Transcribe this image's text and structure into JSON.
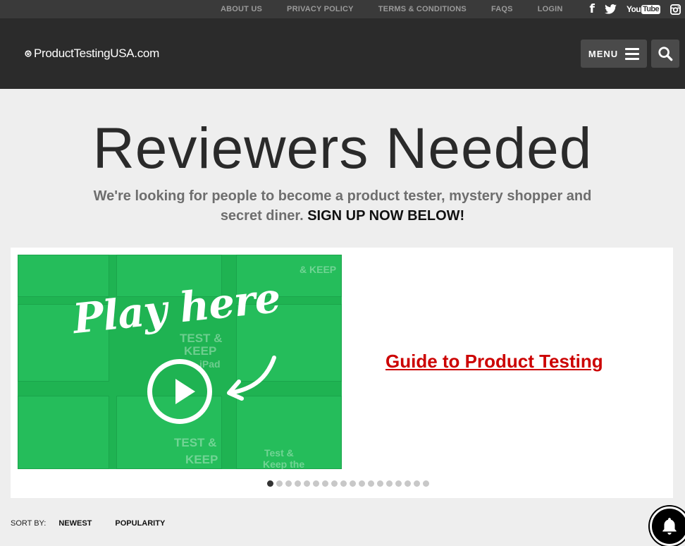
{
  "topbar": {
    "links": [
      "ABOUT US",
      "PRIVACY POLICY",
      "TERMS & CONDITIONS",
      "FAQS",
      "LOGIN"
    ],
    "social": {
      "facebook": "f",
      "youtube_you": "You",
      "youtube_tube": "Tube"
    }
  },
  "header": {
    "logo_text": "ProductTestingUSA.com",
    "menu_label": "MENU"
  },
  "hero": {
    "title": "Reviewers Needed",
    "subtitle": "We're looking for people to become a product tester, mystery shopper and secret diner.",
    "cta": "SIGN UP NOW BELOW!"
  },
  "slider": {
    "video_caption": "Play here",
    "video_bg_words": [
      "TEST &",
      "KEEP",
      "TEST &",
      "KEEP",
      "Test &",
      "Keep the",
      "& KEEP",
      "iPad"
    ],
    "link_text": "Guide to Product Testing",
    "dot_count": 18,
    "active_dot": 0
  },
  "sort": {
    "label": "SORT BY:",
    "options": [
      "NEWEST",
      "POPULARITY"
    ]
  },
  "colors": {
    "topbar_bg": "#3a3a3a",
    "header_bg": "#2b2b2b",
    "video_green": "#1fb352",
    "link_red": "#cc0000"
  }
}
